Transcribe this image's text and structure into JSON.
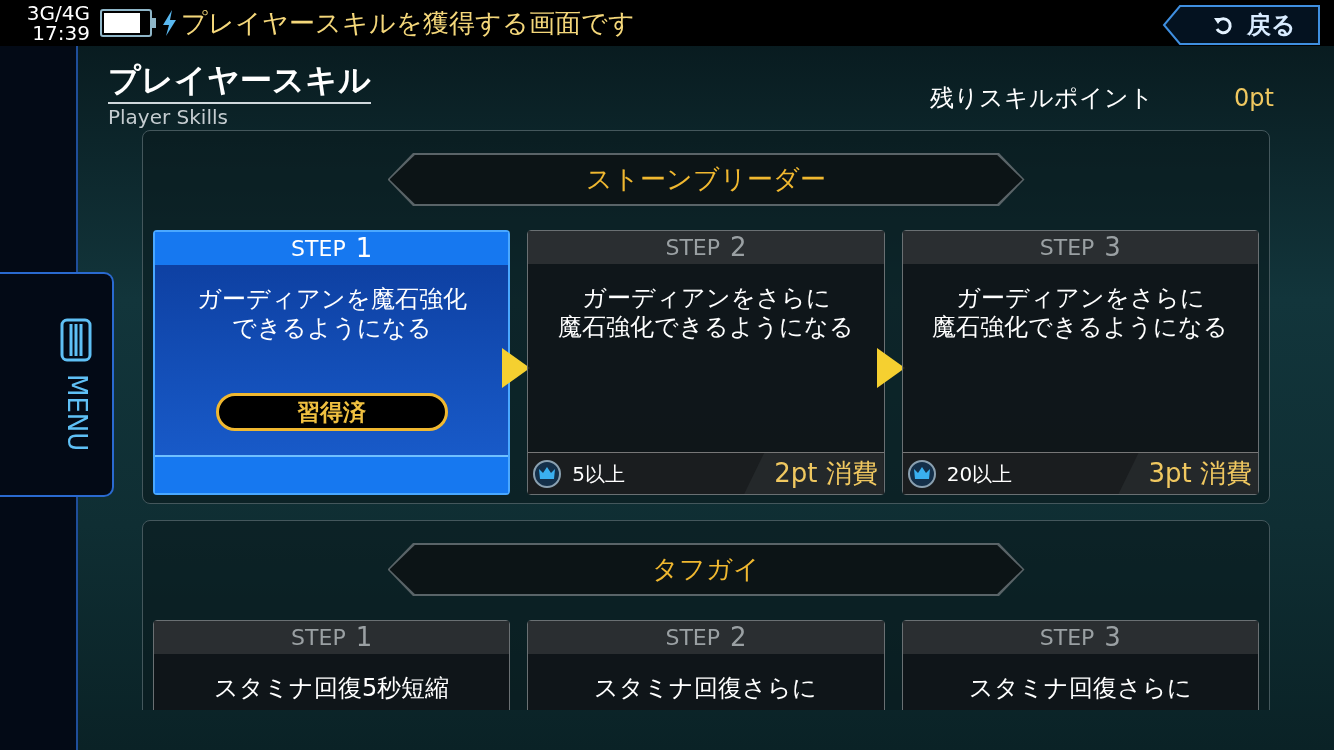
{
  "status_bar": {
    "network": "3G/4G",
    "time": "17:39",
    "message": "プレイヤースキルを獲得する画面です"
  },
  "back_button": {
    "label": "戻る"
  },
  "menu": {
    "label": "MENU"
  },
  "header": {
    "title": "プレイヤースキル",
    "subtitle": "Player Skills"
  },
  "skill_points": {
    "label": "残りスキルポイント",
    "value": "0pt"
  },
  "skills": [
    {
      "name": "ストーンブリーダー",
      "steps": [
        {
          "label": "STEP",
          "number": "1",
          "description_lines": [
            "ガーディアンを魔石強化",
            "できるようになる"
          ],
          "acquired": true,
          "status": "習得済"
        },
        {
          "label": "STEP",
          "number": "2",
          "description_lines": [
            "ガーディアンをさらに",
            "魔石強化できるようになる"
          ],
          "acquired": false,
          "requirement": "5以上",
          "cost": "2pt 消費"
        },
        {
          "label": "STEP",
          "number": "3",
          "description_lines": [
            "ガーディアンをさらに",
            "魔石強化できるようになる"
          ],
          "acquired": false,
          "requirement": "20以上",
          "cost": "3pt 消費"
        }
      ]
    },
    {
      "name": "タフガイ",
      "steps": [
        {
          "label": "STEP",
          "number": "1",
          "description_lines": [
            "スタミナ回復5秒短縮"
          ],
          "acquired": false
        },
        {
          "label": "STEP",
          "number": "2",
          "description_lines": [
            "スタミナ回復さらに"
          ],
          "acquired": false
        },
        {
          "label": "STEP",
          "number": "3",
          "description_lines": [
            "スタミナ回復さらに"
          ],
          "acquired": false
        }
      ]
    }
  ]
}
